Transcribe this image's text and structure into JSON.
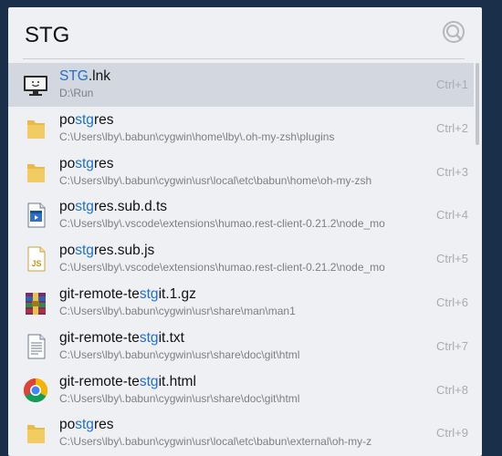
{
  "search": {
    "query": "STG",
    "icon": "search-icon"
  },
  "colors": {
    "highlight": "#1e6fd0",
    "selected_row": "#d3d8e0",
    "panel": "#eef0f3"
  },
  "results": [
    {
      "segments": [
        {
          "t": "STG",
          "h": true
        },
        {
          "t": ".lnk",
          "h": false
        }
      ],
      "path": "D:\\Run",
      "shortcut": "Ctrl+1",
      "icon": "monitor-icon",
      "selected": true
    },
    {
      "segments": [
        {
          "t": "po",
          "h": false
        },
        {
          "t": "stg",
          "h": true
        },
        {
          "t": "res",
          "h": false
        }
      ],
      "path": "C:\\Users\\lby\\.babun\\cygwin\\home\\lby\\.oh-my-zsh\\plugins",
      "shortcut": "Ctrl+2",
      "icon": "folder-icon",
      "selected": false
    },
    {
      "segments": [
        {
          "t": "po",
          "h": false
        },
        {
          "t": "stg",
          "h": true
        },
        {
          "t": "res",
          "h": false
        }
      ],
      "path": "C:\\Users\\lby\\.babun\\cygwin\\usr\\local\\etc\\babun\\home\\oh-my-zsh",
      "shortcut": "Ctrl+3",
      "icon": "folder-icon",
      "selected": false
    },
    {
      "segments": [
        {
          "t": "po",
          "h": false
        },
        {
          "t": "stg",
          "h": true
        },
        {
          "t": "res.sub.d.ts",
          "h": false
        }
      ],
      "path": "C:\\Users\\lby\\.vscode\\extensions\\humao.rest-client-0.21.2\\node_mo",
      "shortcut": "Ctrl+4",
      "icon": "video-file-icon",
      "selected": false
    },
    {
      "segments": [
        {
          "t": "po",
          "h": false
        },
        {
          "t": "stg",
          "h": true
        },
        {
          "t": "res.sub.js",
          "h": false
        }
      ],
      "path": "C:\\Users\\lby\\.vscode\\extensions\\humao.rest-client-0.21.2\\node_mo",
      "shortcut": "Ctrl+5",
      "icon": "js-file-icon",
      "selected": false
    },
    {
      "segments": [
        {
          "t": "git-remote-te",
          "h": false
        },
        {
          "t": "stg",
          "h": true
        },
        {
          "t": "it.1.gz",
          "h": false
        }
      ],
      "path": "C:\\Users\\lby\\.babun\\cygwin\\usr\\share\\man\\man1",
      "shortcut": "Ctrl+6",
      "icon": "archive-icon",
      "selected": false
    },
    {
      "segments": [
        {
          "t": "git-remote-te",
          "h": false
        },
        {
          "t": "stg",
          "h": true
        },
        {
          "t": "it.txt",
          "h": false
        }
      ],
      "path": "C:\\Users\\lby\\.babun\\cygwin\\usr\\share\\doc\\git\\html",
      "shortcut": "Ctrl+7",
      "icon": "text-file-icon",
      "selected": false
    },
    {
      "segments": [
        {
          "t": "git-remote-te",
          "h": false
        },
        {
          "t": "stg",
          "h": true
        },
        {
          "t": "it.html",
          "h": false
        }
      ],
      "path": "C:\\Users\\lby\\.babun\\cygwin\\usr\\share\\doc\\git\\html",
      "shortcut": "Ctrl+8",
      "icon": "chrome-icon",
      "selected": false
    },
    {
      "segments": [
        {
          "t": "po",
          "h": false
        },
        {
          "t": "stg",
          "h": true
        },
        {
          "t": "res",
          "h": false
        }
      ],
      "path": "C:\\Users\\lby\\.babun\\cygwin\\usr\\local\\etc\\babun\\external\\oh-my-z",
      "shortcut": "Ctrl+9",
      "icon": "folder-icon",
      "selected": false
    }
  ]
}
